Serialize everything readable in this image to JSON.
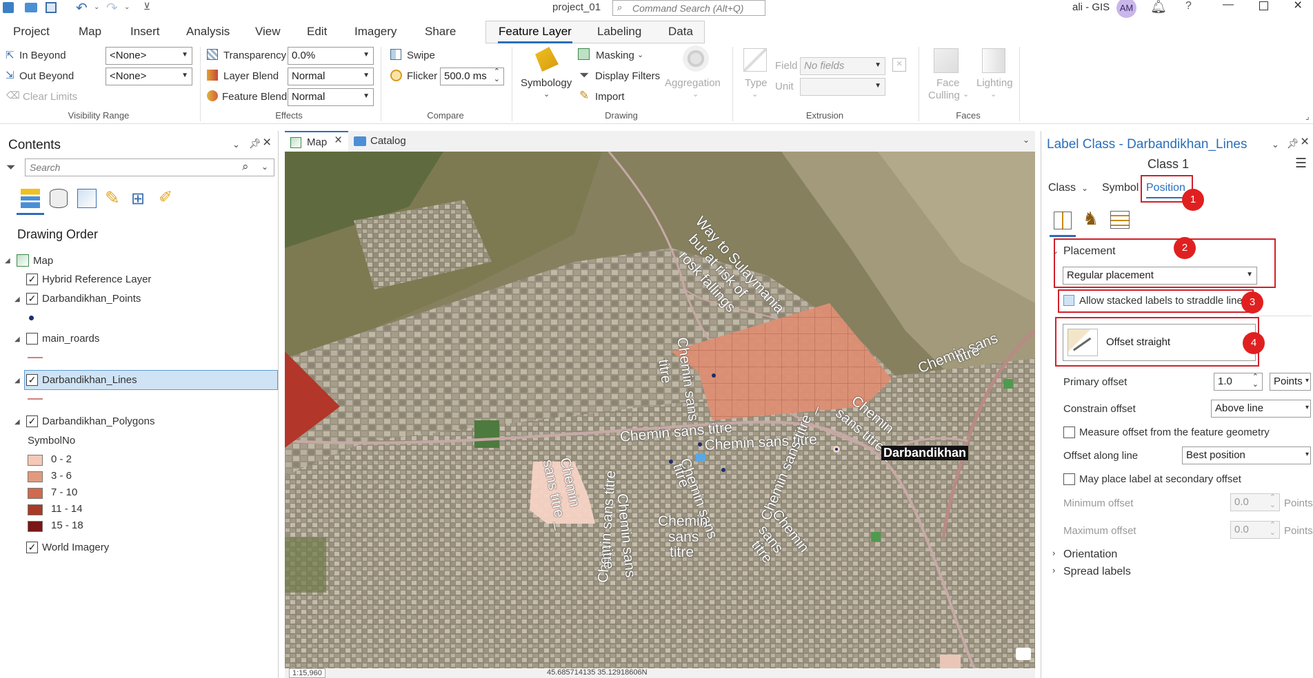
{
  "titlebar": {
    "project": "project_01",
    "command_search_placeholder": "Command Search (Alt+Q)",
    "user": "ali - GIS",
    "avatar": "AM"
  },
  "menu": {
    "items": [
      "Project",
      "Map",
      "Insert",
      "Analysis",
      "View",
      "Edit",
      "Imagery",
      "Share"
    ],
    "contextual": [
      "Feature Layer",
      "Labeling",
      "Data"
    ],
    "active": "Feature Layer"
  },
  "ribbon": {
    "visibility": {
      "in_beyond": "In Beyond",
      "out_beyond": "Out Beyond",
      "in_value": "<None>",
      "out_value": "<None>",
      "clear_limits": "Clear Limits",
      "group": "Visibility Range"
    },
    "effects": {
      "transparency": "Transparency",
      "transparency_value": "0.0%",
      "layer_blend": "Layer Blend",
      "layer_blend_value": "Normal",
      "feature_blend": "Feature Blend",
      "feature_blend_value": "Normal",
      "group": "Effects"
    },
    "compare": {
      "swipe": "Swipe",
      "flicker": "Flicker",
      "flicker_value": "500.0  ms",
      "group": "Compare"
    },
    "drawing": {
      "symbology": "Symbology",
      "masking": "Masking",
      "display_filters": "Display Filters",
      "import": "Import",
      "aggregation": "Aggregation",
      "group": "Drawing"
    },
    "extrusion": {
      "type": "Type",
      "field": "Field",
      "field_value": "No fields",
      "unit": "Unit",
      "group": "Extrusion"
    },
    "faces": {
      "face_culling_1": "Face",
      "face_culling_2": "Culling",
      "lighting": "Lighting",
      "group": "Faces"
    }
  },
  "contents": {
    "title": "Contents",
    "search_placeholder": "Search",
    "drawing_order": "Drawing Order",
    "map": "Map",
    "layers": [
      {
        "name": "Hybrid Reference Layer",
        "checked": true
      },
      {
        "name": "Darbandikhan_Points",
        "checked": true
      },
      {
        "name": "main_roards",
        "checked": false
      },
      {
        "name": "Darbandikhan_Lines",
        "checked": true
      },
      {
        "name": "Darbandikhan_Polygons",
        "checked": true
      },
      {
        "name": "World Imagery",
        "checked": true
      }
    ],
    "symbol_field": "SymbolNo",
    "classes": [
      {
        "label": "0 - 2",
        "color": "#f4c9b8"
      },
      {
        "label": "3 - 6",
        "color": "#e29a7e"
      },
      {
        "label": "7 - 10",
        "color": "#cf6a4e"
      },
      {
        "label": "11 - 14",
        "color": "#a83a26"
      },
      {
        "label": "15 - 18",
        "color": "#7a1616"
      }
    ]
  },
  "mapview": {
    "tabs": [
      "Map",
      "Catalog"
    ],
    "labels": {
      "way1": "Way to Sulaymania",
      "way2": "but at risk of",
      "way3": "rosk fallings",
      "darbandikhan": "Darbandikhan",
      "chemin": "Chemin sans titre",
      "chemin_sans": "Chemin sans",
      "titre": "titre",
      "chemin_w": "Chemin",
      "sans_w": "sans",
      "sans_titre": "sans titre",
      "chemin_sans_titre_cut": "Chemin sans titre _",
      "sans_titre_cut": "sans titre _"
    },
    "scale": "1:15,960",
    "coords": "45.685714135 35.12918606N"
  },
  "labelpane": {
    "title": "Label Class - Darbandikhan_Lines",
    "class_name": "Class 1",
    "tabs": [
      "Class",
      "Symbol",
      "Position"
    ],
    "placement_header": "Placement",
    "placement_value": "Regular placement",
    "allow_stacked": "Allow stacked labels to straddle lines",
    "offset_style": "Offset straight",
    "primary_offset": "Primary offset",
    "primary_offset_value": "1.0",
    "primary_offset_unit": "Points",
    "constrain_offset": "Constrain offset",
    "constrain_offset_value": "Above line",
    "measure_offset": "Measure offset from the feature geometry",
    "offset_along": "Offset along line",
    "offset_along_value": "Best position",
    "secondary_offset": "May place label at secondary offset",
    "min_offset": "Minimum offset",
    "min_offset_value": "0.0",
    "max_offset": "Maximum offset",
    "max_offset_value": "0.0",
    "points": "Points",
    "orientation": "Orientation",
    "spread_labels": "Spread labels",
    "badges": [
      "1",
      "2",
      "3",
      "4"
    ]
  }
}
